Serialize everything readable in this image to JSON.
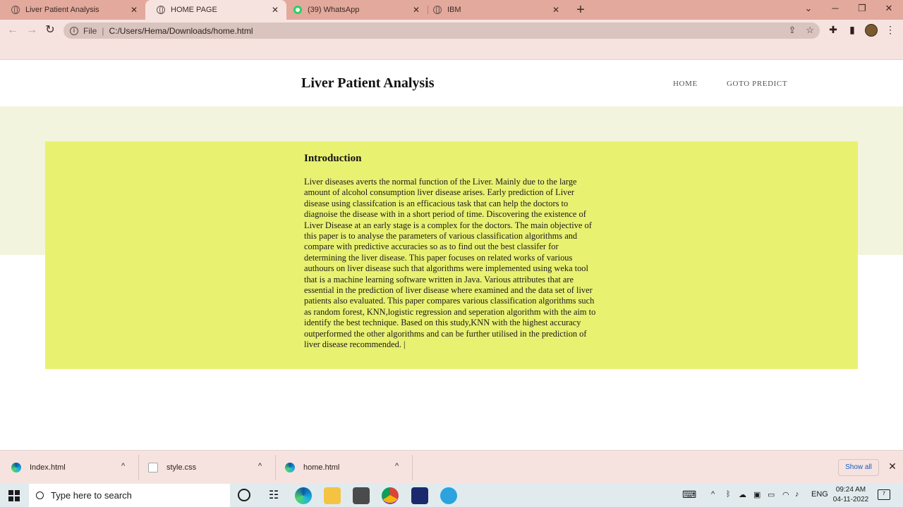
{
  "browser": {
    "tabs": [
      {
        "title": "Liver Patient Analysis",
        "icon": "globe-icon",
        "active": false
      },
      {
        "title": "HOME PAGE",
        "icon": "globe-icon",
        "active": true
      },
      {
        "title": "(39) WhatsApp",
        "icon": "whatsapp-icon",
        "active": false
      },
      {
        "title": "IBM",
        "icon": "globe-icon",
        "active": false
      }
    ],
    "address": {
      "scheme_label": "File",
      "url": "C:/Users/Hema/Downloads/home.html"
    }
  },
  "site": {
    "title": "Liver Patient Analysis",
    "nav": [
      "HOME",
      "GOTO PREDICT"
    ],
    "intro": {
      "heading": "Introduction",
      "body": "Liver diseases averts the normal function of the Liver. Mainly due to the large amount of alcohol consumption liver disease arises. Early prediction of Liver disease using classifcation is an efficacious task that can help the doctors to diagnoise the disease with in a short period of time. Discovering the existence of Liver Disease at an early stage is a complex for the doctors. The main objective of this paper is to analyse the parameters of various classification algorithms and compare with predictive accuracies so as to find out the best classifer for determining the liver disease. This paper focuses on related works of various authours on liver disease such that algorithms were implemented using weka tool that is a machine learning software written in Java. Various attributes that are essential in the prediction of liver disease where examined and the data set of liver patients also evaluated. This paper compares various classification algorithms such as random forest, KNN,logistic regression and seperation algorithm with the aim to identify the best technique. Based on this study,KNN with the highest accuracy outperformed the other algorithms and can be further utilised in the prediction of liver disease recommended. |"
    }
  },
  "downloads": {
    "items": [
      {
        "name": "Index.html",
        "icon": "edge-icon"
      },
      {
        "name": "style.css",
        "icon": "file-icon"
      },
      {
        "name": "home.html",
        "icon": "edge-icon"
      }
    ],
    "show_all_label": "Show all"
  },
  "taskbar": {
    "search_placeholder": "Type here to search",
    "language": "ENG",
    "time": "09:24 AM",
    "date": "04-11-2022",
    "notification_count": "7"
  },
  "colors": {
    "tabbar": "#e3a99c",
    "chrome": "#f6e3df",
    "beige_band": "#f3f4dd",
    "intro_box": "#e9f171"
  }
}
